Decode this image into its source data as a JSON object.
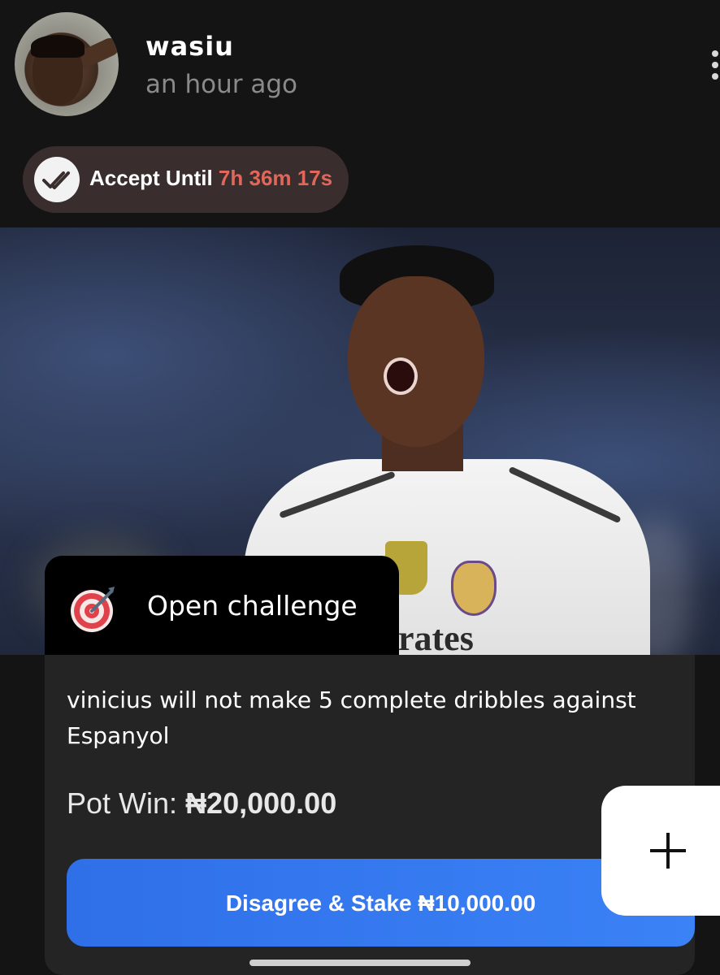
{
  "post": {
    "username": "wasiu",
    "time": "an hour ago",
    "timer_label": "Accept Until",
    "timer_value": "7h 36m 17s"
  },
  "challenge": {
    "tag": "Open challenge",
    "statement": "vinicius will not make 5 complete dribbles against Espanyol",
    "pot_label": "Pot Win:",
    "pot_value": "₦20,000.00",
    "stake_button": "Disagree & Stake ₦10,000.00",
    "image_text": "rates"
  },
  "icons": {
    "more": "more-vertical-icon",
    "check": "double-check-icon",
    "target": "target-icon",
    "add": "plus-icon"
  },
  "colors": {
    "accent_blue": "#3b82f6",
    "timer_red": "#e0675a",
    "background": "#141414",
    "card": "#242424"
  }
}
